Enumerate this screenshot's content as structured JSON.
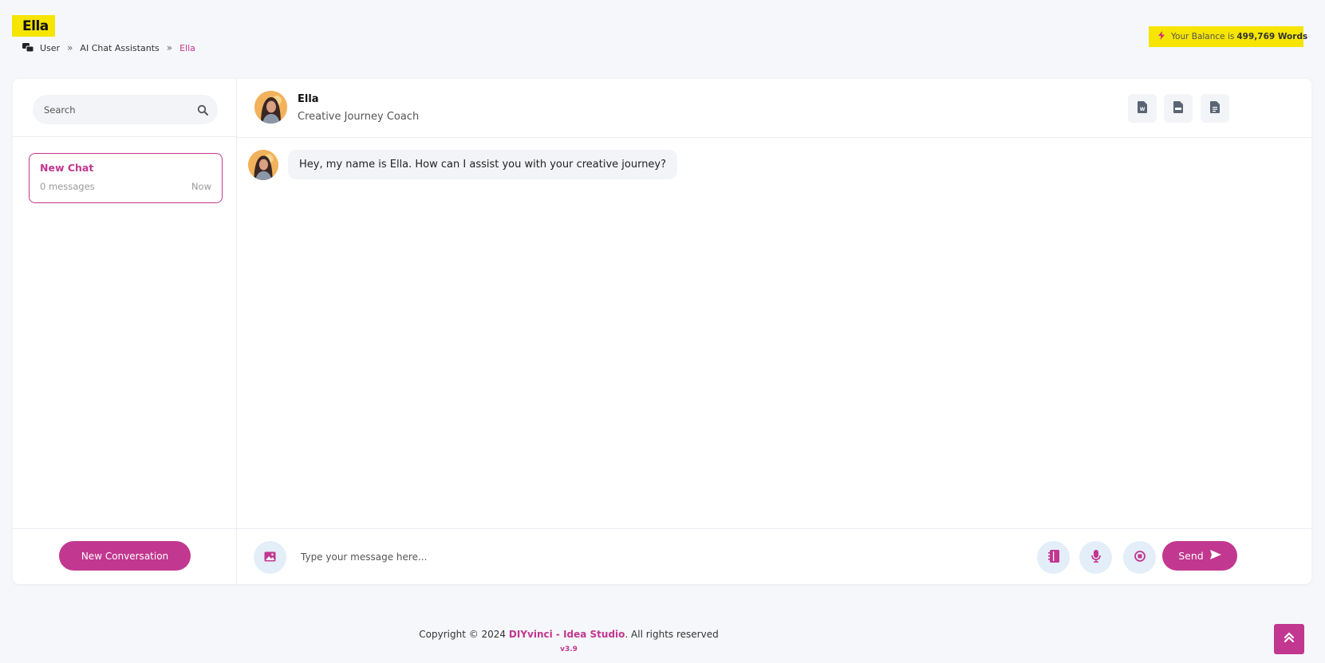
{
  "page": {
    "title": "Ella",
    "breadcrumb": [
      "User",
      "AI Chat Assistants",
      "Ella"
    ],
    "breadcrumb_separator": "»"
  },
  "balance": {
    "prefix": "Your Balance is",
    "value": "499,769 Words"
  },
  "sidebar": {
    "search_placeholder": "Search",
    "chats": [
      {
        "title": "New Chat",
        "count": "0 messages",
        "time": "Now"
      }
    ],
    "new_conversation_label": "New Conversation"
  },
  "assistant": {
    "name": "Ella",
    "role": "Creative Journey Coach"
  },
  "export_icons": [
    "word-doc-icon",
    "pdf-icon",
    "text-doc-icon"
  ],
  "messages": [
    {
      "sender": "assistant",
      "text": "Hey, my name is Ella. How can I assist you with your creative journey?"
    }
  ],
  "composer": {
    "placeholder": "Type your message here...",
    "send_label": "Send"
  },
  "footer": {
    "copyright_prefix": "Copyright © 2024",
    "brand": "DIYvinci - Idea Studio",
    "suffix": ". All rights reserved",
    "version": "v3.9"
  },
  "colors": {
    "accent": "#c2378f",
    "highlight": "#f5e500",
    "icon_bg": "#e3eef9"
  }
}
